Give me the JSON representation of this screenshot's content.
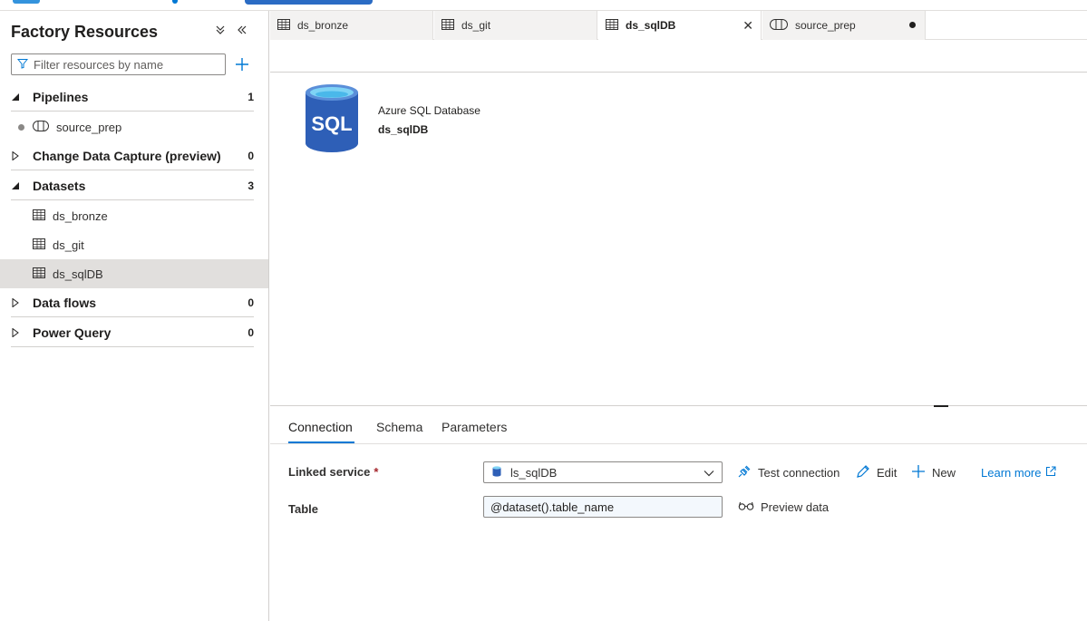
{
  "colors": {
    "accent": "#0078d4",
    "selected_row": "#e1dfdd",
    "required": "#a4262c",
    "sql_blue": "#2e5fb7"
  },
  "left_panel": {
    "title": "Factory Resources",
    "filter_placeholder": "Filter resources by name",
    "sections": [
      {
        "label": "Pipelines",
        "count": "1",
        "expanded": true,
        "items": [
          "source_prep"
        ]
      },
      {
        "label": "Change Data Capture (preview)",
        "count": "0",
        "expanded": false
      },
      {
        "label": "Datasets",
        "count": "3",
        "expanded": true,
        "items": [
          "ds_bronze",
          "ds_git",
          "ds_sqlDB"
        ]
      },
      {
        "label": "Data flows",
        "count": "0",
        "expanded": false
      },
      {
        "label": "Power Query",
        "count": "0",
        "expanded": false
      }
    ]
  },
  "tabs": [
    {
      "label": "ds_bronze",
      "icon": "table-icon"
    },
    {
      "label": "ds_git",
      "icon": "table-icon"
    },
    {
      "label": "ds_sqlDB",
      "icon": "table-icon",
      "active": true
    },
    {
      "label": "source_prep",
      "icon": "pipeline-icon",
      "unsaved": true
    }
  ],
  "canvas": {
    "icon_text": "SQL",
    "dataset_type": "Azure SQL Database",
    "dataset_name": "ds_sqlDB"
  },
  "bottom": {
    "tabs": [
      "Connection",
      "Schema",
      "Parameters"
    ],
    "active_tab": "Connection",
    "linked_service_label": "Linked service",
    "required_mark": "*",
    "linked_service_value": "ls_sqlDB",
    "test_connection": "Test connection",
    "edit": "Edit",
    "new": "New",
    "learn_more": "Learn more",
    "table_label": "Table",
    "table_value": "@dataset().table_name",
    "preview_data": "Preview data"
  }
}
